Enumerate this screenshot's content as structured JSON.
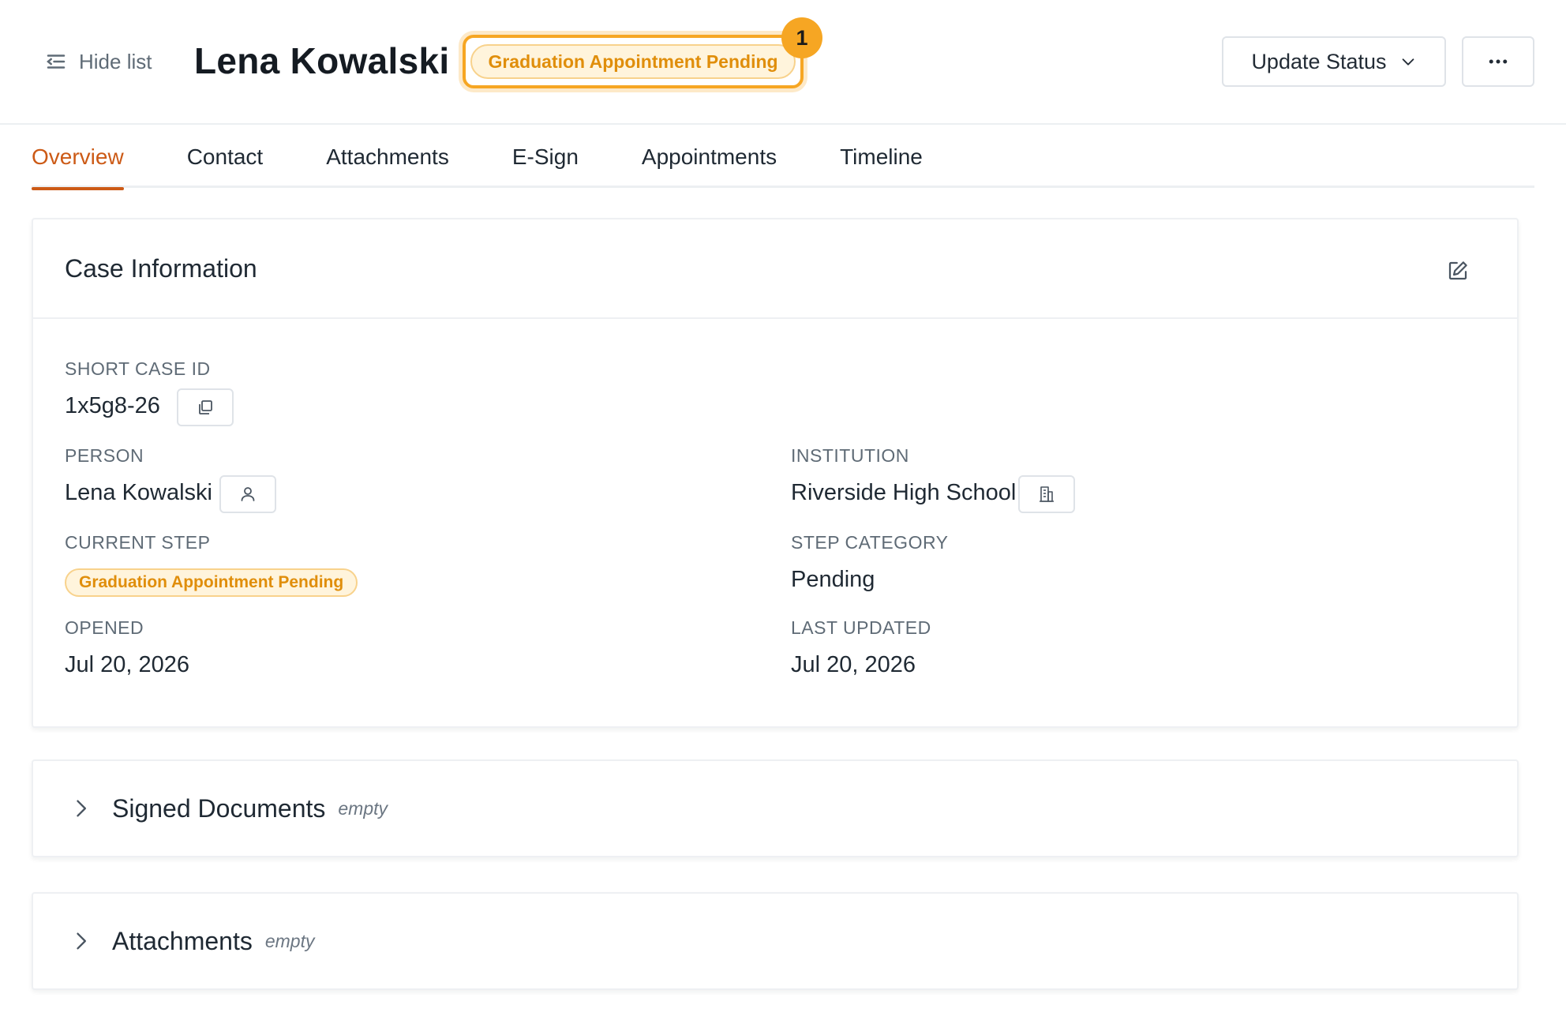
{
  "header": {
    "hide_list_label": "Hide list",
    "title": "Lena Kowalski",
    "status_badge": "Graduation Appointment Pending",
    "notification_count": "1",
    "update_status_label": "Update Status",
    "accent_color": "#f6a623"
  },
  "tabs": [
    {
      "label": "Overview",
      "active": true
    },
    {
      "label": "Contact"
    },
    {
      "label": "Attachments"
    },
    {
      "label": "E-Sign"
    },
    {
      "label": "Appointments"
    },
    {
      "label": "Timeline"
    }
  ],
  "case_info": {
    "title": "Case Information",
    "short_case_id_label": "SHORT CASE ID",
    "short_case_id": "1x5g8-26",
    "person_label": "PERSON",
    "person": "Lena Kowalski",
    "institution_label": "INSTITUTION",
    "institution": "Riverside High School",
    "current_step_label": "CURRENT STEP",
    "current_step": "Graduation Appointment Pending",
    "step_category_label": "STEP CATEGORY",
    "step_category": "Pending",
    "opened_label": "OPENED",
    "opened": "Jul 20, 2026",
    "last_updated_label": "LAST UPDATED",
    "last_updated": "Jul 20, 2026"
  },
  "sections": [
    {
      "title": "Signed Documents",
      "state": "empty"
    },
    {
      "title": "Attachments",
      "state": "empty"
    }
  ],
  "icons": {
    "hide_list": "list-collapse-icon",
    "dropdown": "chevron-down-icon",
    "more": "ellipsis-icon",
    "edit": "edit-icon",
    "copy": "copy-icon",
    "person": "user-icon",
    "institution": "building-icon",
    "section_toggle": "chevron-right-icon"
  }
}
